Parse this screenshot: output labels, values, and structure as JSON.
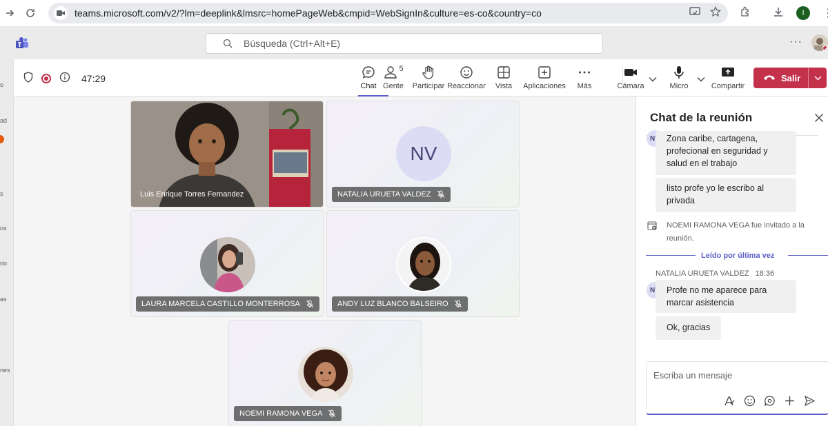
{
  "browser": {
    "url": "teams.microsoft.com/v2/?lm=deeplink&lmsrc=homePageWeb&cmpid=WebSignIn&culture=es-co&country=co",
    "profile_initial": "I"
  },
  "teams": {
    "search_placeholder": "Búsqueda (Ctrl+Alt+E)",
    "more": "···"
  },
  "rail": {
    "labels": [
      "o",
      "ad",
      "s",
      "os",
      "rio",
      "as",
      "nes"
    ]
  },
  "meeting": {
    "timer": "47:29",
    "people_count": "5",
    "tools": {
      "chat": "Chat",
      "people": "Gente",
      "raise": "Participar",
      "react": "Reaccionar",
      "view": "Vista",
      "apps": "Aplicaciones",
      "more": "Más",
      "camera": "Cámara",
      "mic": "Micro",
      "share": "Compartir"
    },
    "leave_label": "Salir"
  },
  "participants": [
    {
      "name": "Luis Enrique Torres Fernandez"
    },
    {
      "name": "NATALIA URUETA VALDEZ",
      "initials": "NV"
    },
    {
      "name": "LAURA MARCELA CASTILLO MONTERROSA"
    },
    {
      "name": "ANDY LUZ BLANCO BALSEIRO"
    },
    {
      "name": "NOEMI RAMONA VEGA"
    }
  ],
  "chat": {
    "title": "Chat de la reunión",
    "messages": [
      {
        "initials": "NV",
        "text": "Zona caribe, cartagena, profecional en seguridad y salud en el trabajo"
      },
      {
        "text": "listo profe yo le escribo al privada"
      },
      {
        "system": "NOEMI RAMONA VEGA fue invitado a la reunión."
      },
      {
        "read_marker": "Leído por última vez"
      },
      {
        "sender": "NATALIA URUETA VALDEZ",
        "time": "18:36"
      },
      {
        "initials": "NV",
        "text": "Profe no me aparece para marcar asistencia"
      },
      {
        "text": "Ok, gracias"
      }
    ],
    "compose_placeholder": "Escriba un mensaje"
  },
  "colors": {
    "accent": "#5b5fc7",
    "leave": "#c4314b"
  }
}
